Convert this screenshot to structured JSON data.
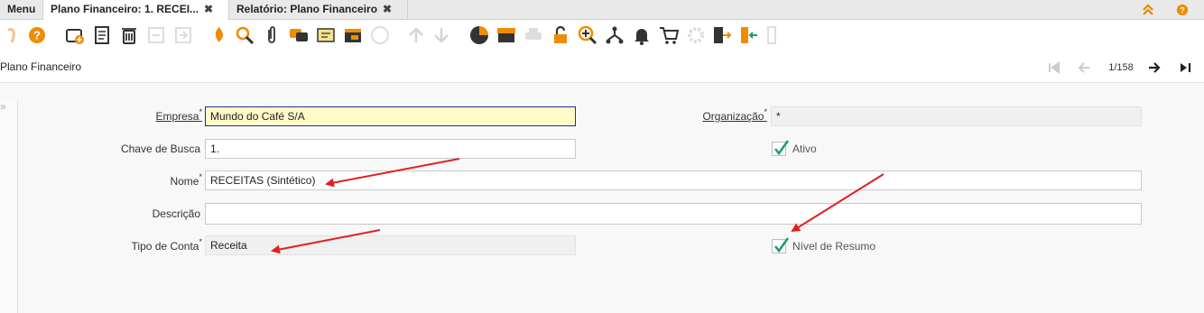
{
  "tabs": [
    {
      "label": "Menu"
    },
    {
      "label": "Plano Financeiro: 1. RECEI...",
      "close": "✖"
    },
    {
      "label": "Relatório: Plano Financeiro",
      "close": "✖"
    }
  ],
  "toolbar_icons": [
    "undo-icon",
    "help-icon",
    "new-record-icon",
    "copy-record-icon",
    "delete-icon",
    "save-icon",
    "save-new-icon",
    "refresh-icon",
    "find-icon",
    "attachment-icon",
    "chat-icon",
    "notes-icon",
    "history-icon",
    "palette-icon",
    "previous-record-icon",
    "next-record-icon",
    "report-icon",
    "archive-icon",
    "print-icon",
    "unlock-icon",
    "zoom-icon",
    "workflow-icon",
    "alert-icon",
    "product-icon",
    "settings-icon",
    "exit-icon",
    "import-icon",
    "export-icon"
  ],
  "header": {
    "title": "Plano Financeiro",
    "record_counter": "1/158"
  },
  "form": {
    "empresa": {
      "label": "Empresa",
      "value": "Mundo do Café S/A"
    },
    "organizacao": {
      "label": "Organização",
      "value": "*"
    },
    "chave_busca": {
      "label": "Chave de Busca",
      "value": "1."
    },
    "ativo": {
      "label": "Ativo",
      "checked": true
    },
    "nome": {
      "label": "Nome",
      "value": "RECEITAS (Sintético)"
    },
    "descricao": {
      "label": "Descrição",
      "value": ""
    },
    "tipo_conta": {
      "label": "Tipo de Conta",
      "value": "Receita"
    },
    "nivel_resumo": {
      "label": "Nível de Resumo",
      "checked": true
    },
    "required_marker": "*"
  },
  "colors": {
    "accent_orange": "#f08c00",
    "mandatory_bg": "#fffbc8",
    "annotation_red": "#e02020",
    "check_green": "#1a9e6a"
  }
}
